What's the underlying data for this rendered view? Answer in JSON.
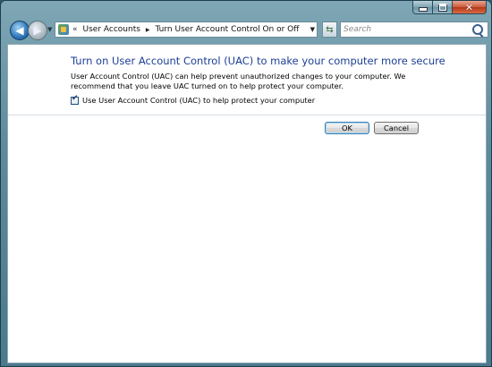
{
  "nav": {
    "breadcrumbs": [
      "User Accounts",
      "Turn User Account Control On or Off"
    ],
    "overflow": "«",
    "search_placeholder": "Search"
  },
  "main": {
    "heading": "Turn on User Account Control (UAC) to make your computer more secure",
    "description": "User Account Control (UAC) can help prevent unauthorized changes to your computer.  We recommend that you leave UAC turned on to help protect your computer.",
    "checkbox": {
      "label": "Use User Account Control (UAC) to help protect your computer",
      "checked": true
    }
  },
  "buttons": {
    "ok": "OK",
    "cancel": "Cancel"
  },
  "colors": {
    "heading": "#1e3e96",
    "frame": "#5d8a9c"
  }
}
